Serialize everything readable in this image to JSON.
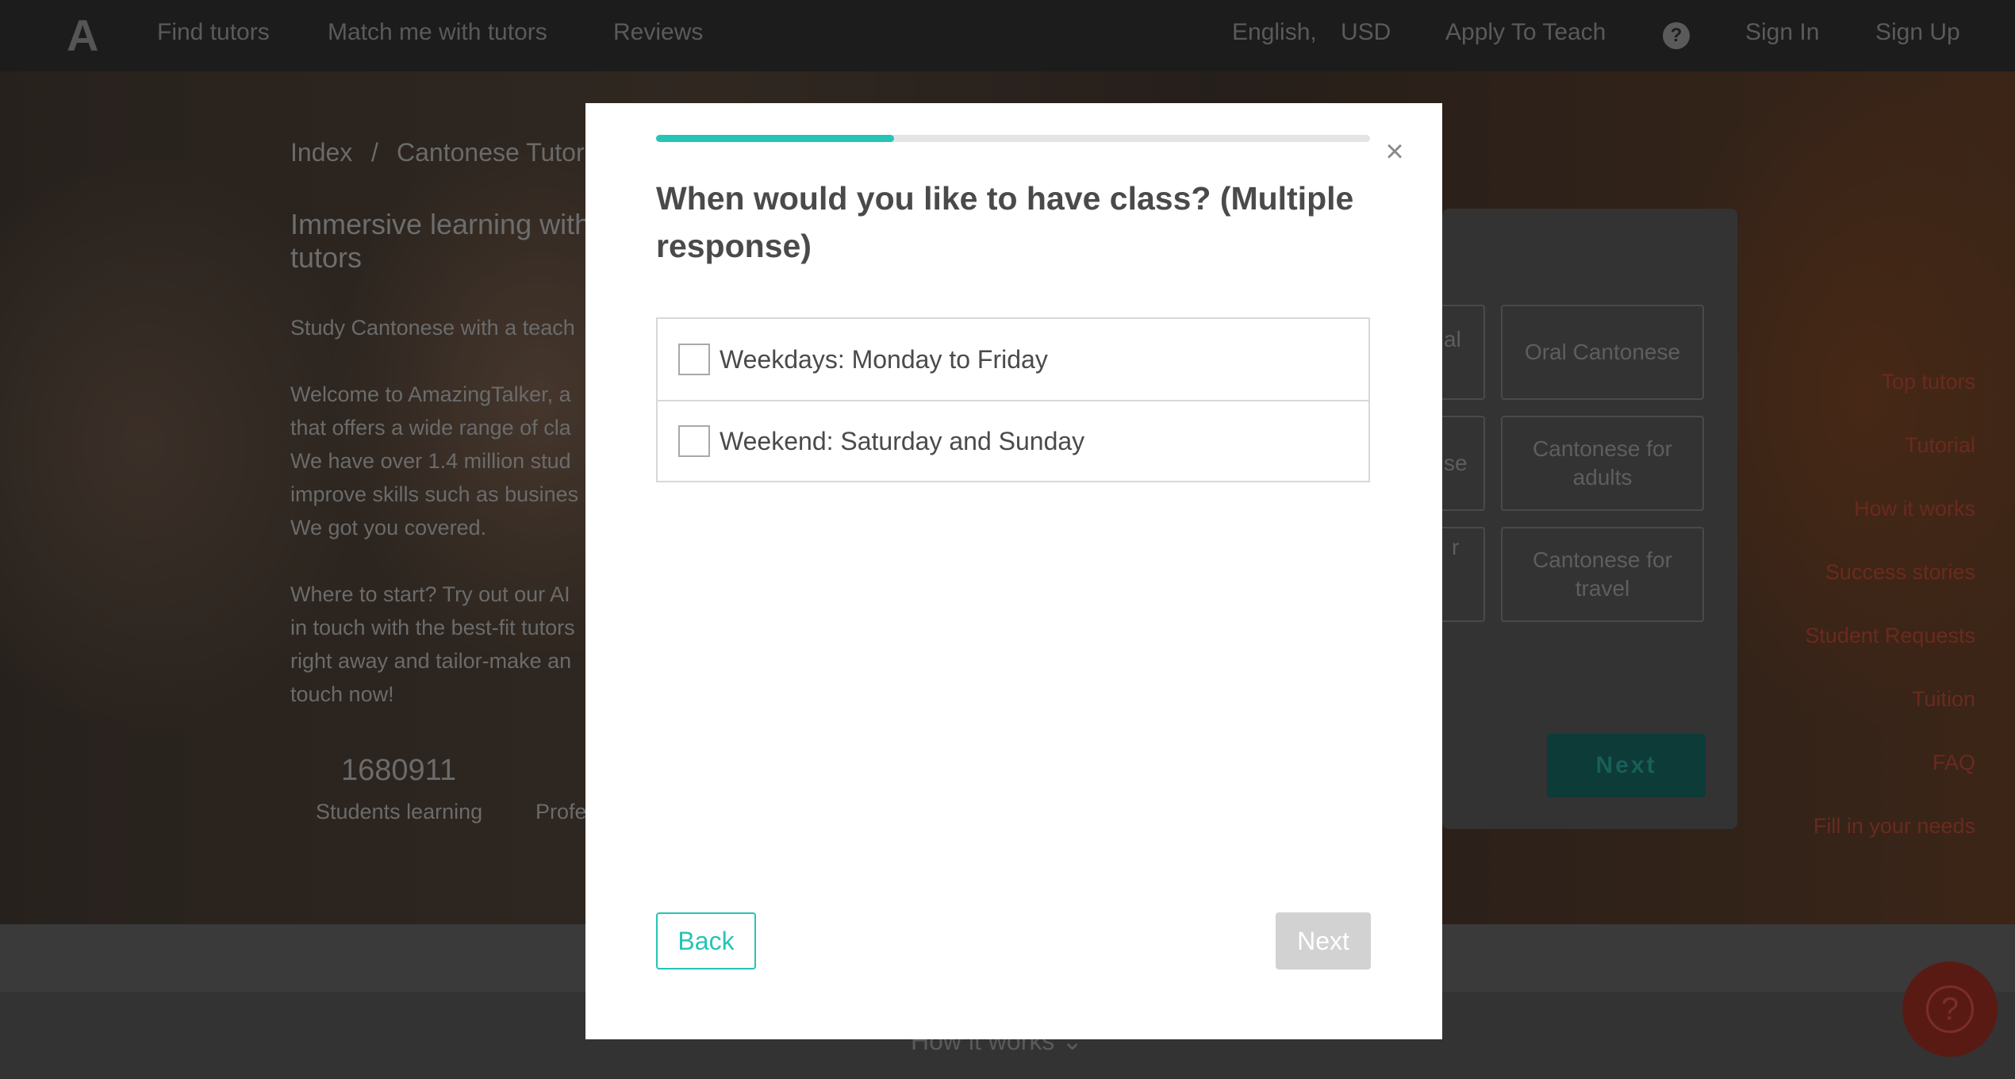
{
  "background": {
    "nav": {
      "logo": "A",
      "find_tutors": "Find tutors",
      "match_me": "Match me with tutors",
      "reviews": "Reviews",
      "language": "English,",
      "currency": "USD",
      "apply": "Apply To Teach",
      "help_icon": "?",
      "sign_in": "Sign In",
      "sign_up": "Sign Up"
    },
    "breadcrumb": {
      "home": "Index",
      "separator": "/",
      "current": "Cantonese Tutor"
    },
    "hero_title_line1": "Immersive learning with",
    "hero_title_line2": "tutors",
    "study_line": "Study Cantonese with a teach",
    "para1": [
      "Welcome to AmazingTalker, a",
      "that offers a wide range of cla",
      "We have over 1.4 million stud",
      "improve skills such as busines",
      "We got you covered."
    ],
    "para2": [
      "Where to start? Try out our AI",
      "in touch with the best-fit tutors",
      "right away and tailor-make an",
      "touch now!"
    ],
    "stats": {
      "students_count": "1680911",
      "students_label": "Students learning",
      "prof_label": "Profe"
    },
    "card_options": {
      "left_partials": [
        "al",
        "se",
        "r"
      ],
      "oral": "Oral Cantonese",
      "adults": "Cantonese for adults",
      "travel": "Cantonese for travel",
      "next": "Next"
    },
    "side_links": [
      "Top tutors",
      "Tutorial",
      "How it works",
      "Success stories",
      "Student Requests",
      "Tuition",
      "FAQ",
      "Fill in your needs"
    ],
    "how_it_works": "How it works"
  },
  "modal": {
    "progress_percent": 33.3,
    "close_icon": "×",
    "question": "When would you like to have class? (Multiple response)",
    "options": [
      {
        "label": "Weekdays: Monday to Friday",
        "checked": false
      },
      {
        "label": "Weekend: Saturday and Sunday",
        "checked": false
      }
    ],
    "back_label": "Back",
    "next_label": "Next"
  },
  "colors": {
    "accent": "#26c4b6",
    "disabled": "#d2d2d2",
    "text": "#4a4a4a"
  }
}
